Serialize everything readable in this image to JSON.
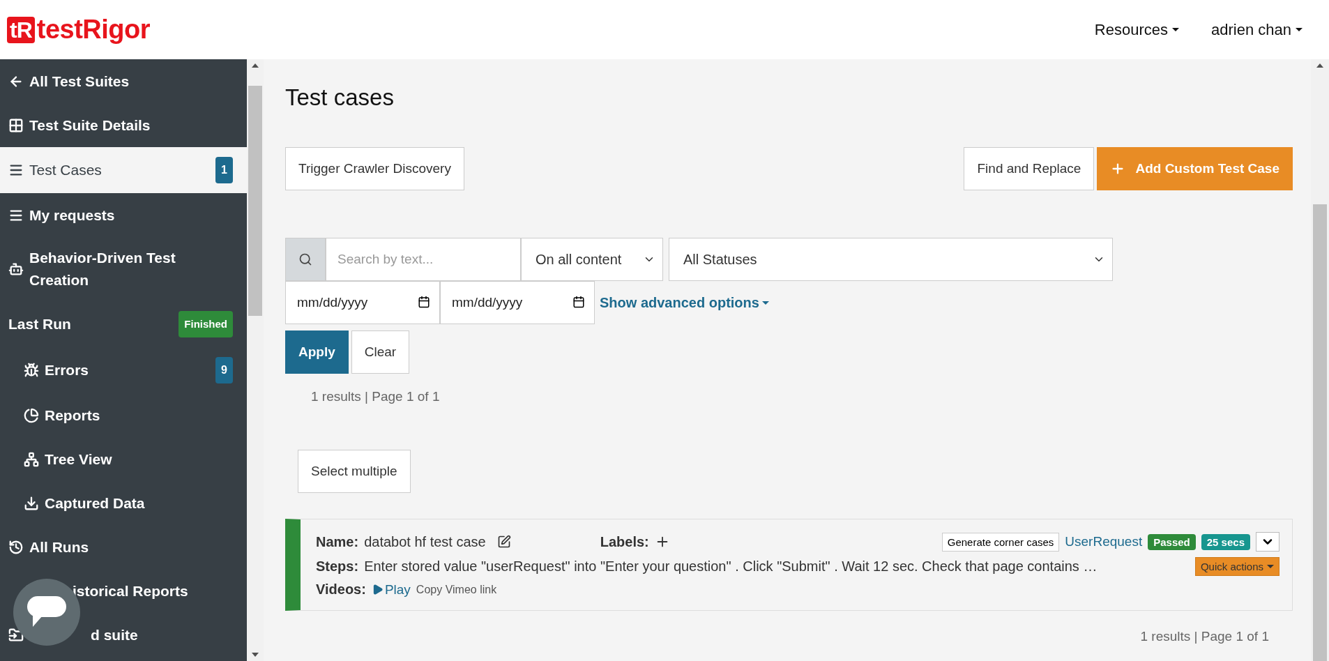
{
  "header": {
    "logo": {
      "mark": "tR",
      "name": "testRigor"
    },
    "menus": [
      {
        "label": "Resources"
      },
      {
        "label": "adrien chan"
      }
    ]
  },
  "sidebar": {
    "items": [
      {
        "label": "All Test Suites",
        "selected": false
      },
      {
        "label": "Test Suite Details",
        "selected": false
      },
      {
        "label": "Test Cases",
        "selected": true,
        "badge": {
          "text": "1",
          "color": "#1d6a8e"
        }
      },
      {
        "label": "My requests",
        "selected": false
      },
      {
        "label": "Behavior-Driven Test Creation",
        "selected": false
      },
      {
        "label": "Last Run",
        "selected": false,
        "badge": {
          "text": "Finished",
          "color": "#2e8b3a"
        },
        "children": [
          {
            "label": "Errors",
            "selected": false,
            "badge": {
              "text": "9",
              "color": "#1d6a8e"
            }
          },
          {
            "label": "Reports",
            "selected": false
          },
          {
            "label": "Tree View",
            "selected": false
          },
          {
            "label": "Captured Data",
            "selected": false
          }
        ]
      },
      {
        "label": "All Runs",
        "selected": false,
        "children": [
          {
            "label": "istorical Reports",
            "selected": false
          }
        ]
      },
      {
        "label": "d suite",
        "selected": false
      }
    ]
  },
  "main": {
    "title": "Test cases",
    "actions_left": [
      {
        "label": "Trigger Crawler Discovery",
        "kind": "default"
      }
    ],
    "actions_right": [
      {
        "label": "Find and Replace",
        "kind": "default"
      },
      {
        "label": "Add Custom Test Case",
        "kind": "add"
      }
    ],
    "filters": {
      "search": {
        "placeholder": "Search by text..."
      },
      "scope": {
        "value": "On all content"
      },
      "status": {
        "value": "All Statuses"
      },
      "date_from": {
        "placeholder": "mm/dd/yyyy"
      },
      "date_to": {
        "placeholder": "mm/dd/yyyy"
      },
      "advanced_link": "Show advanced options",
      "buttons": [
        {
          "label": "Apply",
          "kind": "primary"
        },
        {
          "label": "Clear",
          "kind": "default"
        }
      ]
    },
    "summary_top": "1 results | Page 1 of 1",
    "select_multiple": "Select multiple",
    "test_cases": [
      {
        "name_label": "Name:",
        "name": "databot hf test case",
        "labels_label": "Labels:",
        "generate": "Generate corner cases",
        "request_link": "UserRequest",
        "badges": [
          {
            "text": "Passed",
            "color": "#2e8b3a"
          },
          {
            "text": "25 secs",
            "color": "#17968f"
          }
        ],
        "steps_label": "Steps:",
        "steps": "Enter stored value \"userRequest\" into \"Enter your question\" . Click \"Submit\" . Wait 12 sec. Check that page contains …",
        "quick_actions": "Quick actions",
        "videos_label": "Videos:",
        "play": "Play",
        "copy_link": "Copy Vimeo link"
      }
    ],
    "summary_bottom": "1 results | Page 1 of 1"
  }
}
